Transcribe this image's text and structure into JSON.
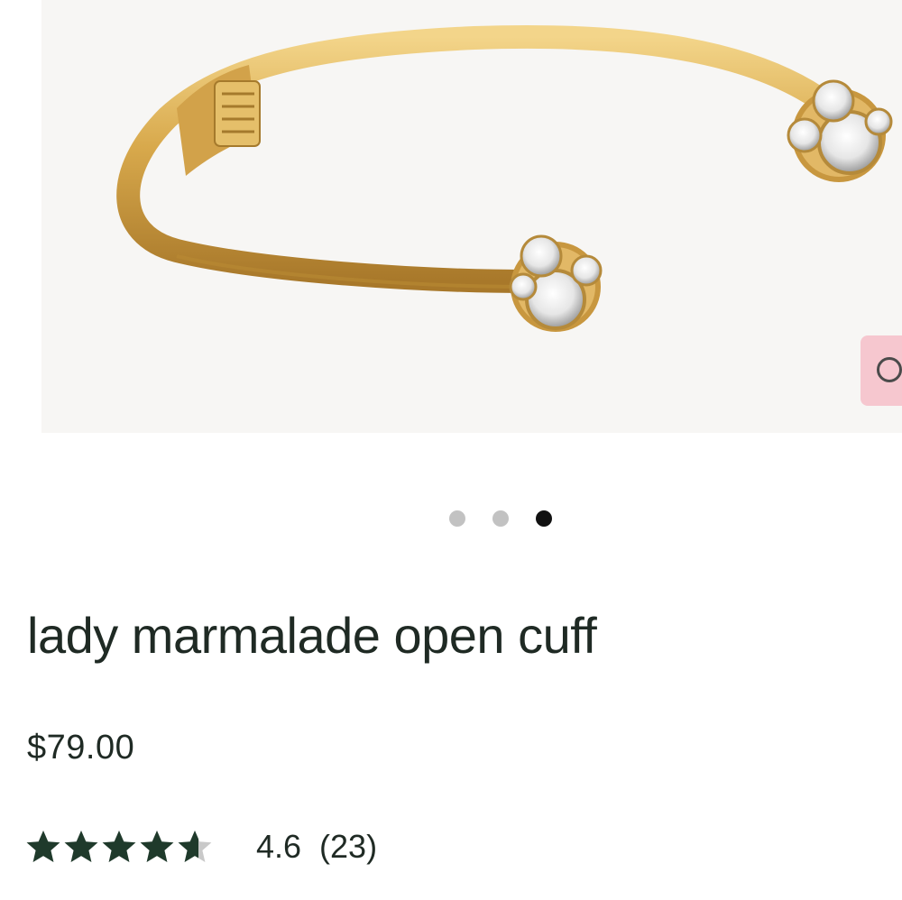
{
  "product": {
    "title": "lady marmalade open cuff",
    "price": "$79.00",
    "rating": 4.6,
    "rating_text": "4.6",
    "review_count": "(23)",
    "image_dots": {
      "count": 3,
      "active_index": 2
    }
  },
  "icons": {
    "compare": "circle-outline-icon",
    "star": "star-icon"
  },
  "colors": {
    "text": "#1f2a24",
    "star": "#1f3a2b",
    "compare_tab": "#f6c7cf",
    "dot_active": "#111111",
    "dot_inactive": "#c2c2c2"
  }
}
